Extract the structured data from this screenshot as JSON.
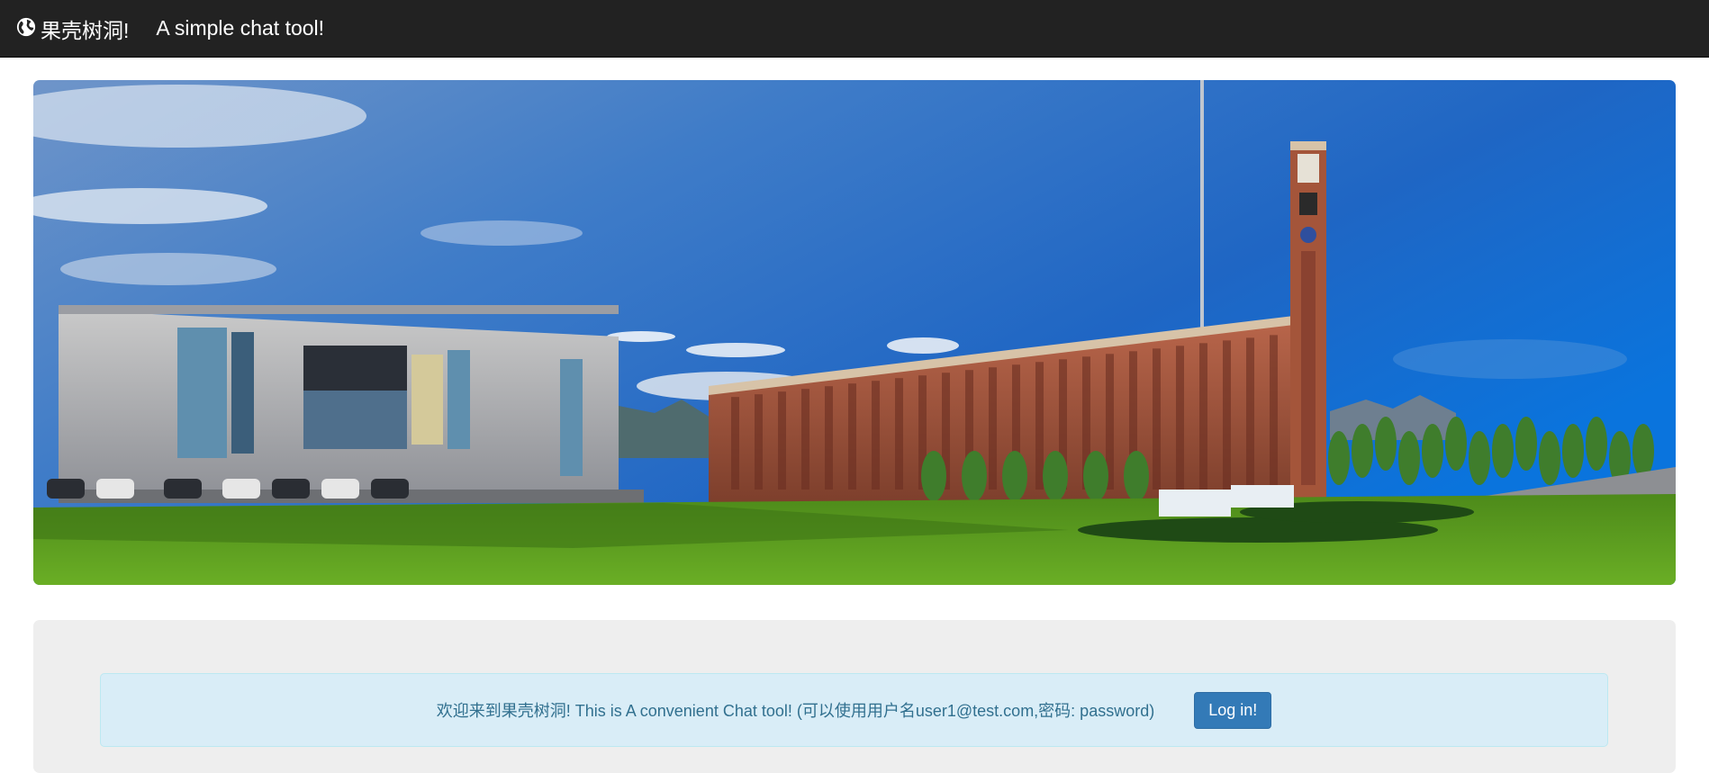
{
  "navbar": {
    "brand_icon": "globe-icon",
    "brand": "果壳树洞!",
    "tagline": "A simple chat tool!"
  },
  "hero": {
    "image": "campus-panorama",
    "colors": {
      "sky_top": "#1f5fb8",
      "sky_right": "#0a72d8",
      "grass": "#5a9c1f",
      "brick": "#a4553a"
    }
  },
  "welcome": {
    "message": "欢迎来到果壳树洞!    This is A convenient Chat tool!  (可以使用用户名user1@test.com,密码: password)",
    "login_label": "Log in!"
  },
  "colors": {
    "navbar_bg": "#222222",
    "alert_bg": "#d9edf7",
    "alert_text": "#31708f",
    "button_bg": "#337ab7",
    "jumbotron_bg": "#eeeeee"
  }
}
